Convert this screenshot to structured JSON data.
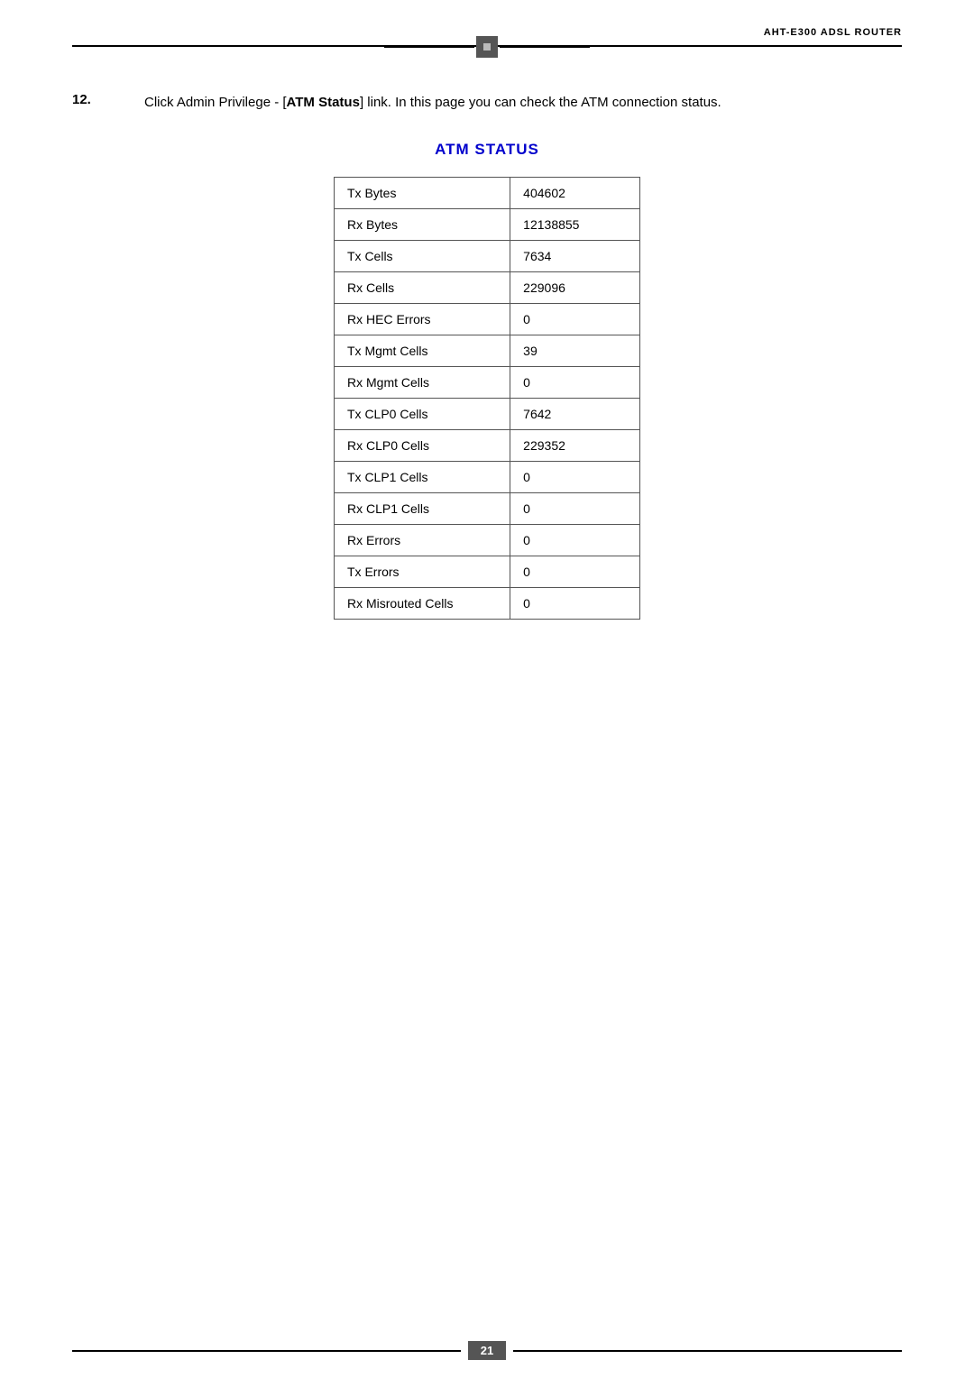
{
  "header": {
    "brand": "AHT-E300 ADSL ROUTER"
  },
  "instruction": {
    "number": "12.",
    "text_before": "Click Admin Privilege - [",
    "link_text": "ATM Status",
    "text_after": "] link. In this page you can check the ATM connection status."
  },
  "atm_status": {
    "title": "ATM STATUS",
    "table_rows": [
      {
        "label": "Tx Bytes",
        "value": "404602"
      },
      {
        "label": "Rx Bytes",
        "value": "12138855"
      },
      {
        "label": "Tx Cells",
        "value": "7634"
      },
      {
        "label": "Rx Cells",
        "value": "229096"
      },
      {
        "label": "Rx HEC Errors",
        "value": "0"
      },
      {
        "label": "Tx Mgmt Cells",
        "value": "39"
      },
      {
        "label": "Rx Mgmt Cells",
        "value": "0"
      },
      {
        "label": "Tx CLP0 Cells",
        "value": "7642"
      },
      {
        "label": "Rx CLP0 Cells",
        "value": "229352"
      },
      {
        "label": "Tx CLP1 Cells",
        "value": "0"
      },
      {
        "label": "Rx CLP1 Cells",
        "value": "0"
      },
      {
        "label": "Rx Errors",
        "value": "0"
      },
      {
        "label": "Tx Errors",
        "value": "0"
      },
      {
        "label": "Rx Misrouted Cells",
        "value": "0"
      }
    ]
  },
  "footer": {
    "page_number": "21"
  }
}
